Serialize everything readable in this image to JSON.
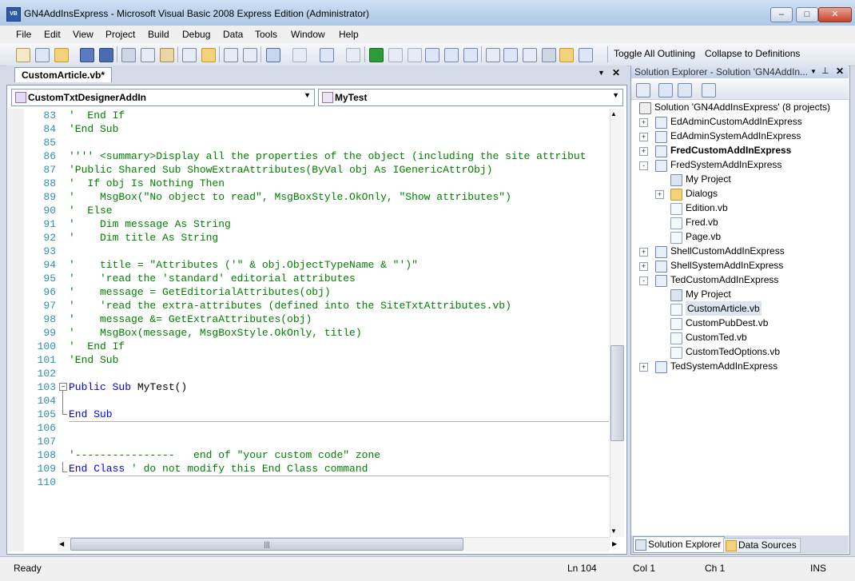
{
  "window": {
    "title": "GN4AddInsExpress - Microsoft Visual Basic 2008 Express Edition (Administrator)",
    "app_icon": "VB"
  },
  "window_buttons": {
    "minimize": "–",
    "maximize": "□",
    "close": "✕"
  },
  "menu": [
    "File",
    "Edit",
    "View",
    "Project",
    "Build",
    "Debug",
    "Data",
    "Tools",
    "Window",
    "Help"
  ],
  "toolbar": {
    "toggle_outlining": "Toggle All Outlining",
    "collapse_defs": "Collapse to Definitions"
  },
  "editor": {
    "tab": "CustomArticle.vb*",
    "tab_close": "✕",
    "class_combo": "CustomTxtDesignerAddIn",
    "method_combo": "MyTest",
    "lines": [
      {
        "n": "83",
        "parts": [
          {
            "s": "'  End If",
            "c": "c"
          }
        ]
      },
      {
        "n": "84",
        "parts": [
          {
            "s": "'End Sub",
            "c": "c"
          }
        ]
      },
      {
        "n": "85",
        "parts": []
      },
      {
        "n": "86",
        "parts": [
          {
            "s": "'''' <summary>Display all the properties of the object (including the site attribut",
            "c": "c"
          }
        ]
      },
      {
        "n": "87",
        "parts": [
          {
            "s": "'Public Shared Sub ShowExtraAttributes(ByVal obj As IGenericAttrObj)",
            "c": "c"
          }
        ]
      },
      {
        "n": "88",
        "parts": [
          {
            "s": "'  If obj Is Nothing Then",
            "c": "c"
          }
        ]
      },
      {
        "n": "89",
        "parts": [
          {
            "s": "'    MsgBox(\"No object to read\", MsgBoxStyle.OkOnly, \"Show attributes\")",
            "c": "c"
          }
        ]
      },
      {
        "n": "90",
        "parts": [
          {
            "s": "'  Else",
            "c": "c"
          }
        ]
      },
      {
        "n": "91",
        "parts": [
          {
            "s": "'    Dim message As String",
            "c": "c"
          }
        ]
      },
      {
        "n": "92",
        "parts": [
          {
            "s": "'    Dim title As String",
            "c": "c"
          }
        ]
      },
      {
        "n": "93",
        "parts": []
      },
      {
        "n": "94",
        "parts": [
          {
            "s": "'    title = \"Attributes ('\" & obj.ObjectTypeName & \"')\"",
            "c": "c"
          }
        ]
      },
      {
        "n": "95",
        "parts": [
          {
            "s": "'    'read the 'standard' editorial attributes",
            "c": "c"
          }
        ]
      },
      {
        "n": "96",
        "parts": [
          {
            "s": "'    message = GetEditorialAttributes(obj)",
            "c": "c"
          }
        ]
      },
      {
        "n": "97",
        "parts": [
          {
            "s": "'    'read the extra-attributes (defined into the SiteTxtAttributes.vb)",
            "c": "c"
          }
        ]
      },
      {
        "n": "98",
        "parts": [
          {
            "s": "'    message &= GetExtraAttributes(obj)",
            "c": "c"
          }
        ]
      },
      {
        "n": "99",
        "parts": [
          {
            "s": "'    MsgBox(message, MsgBoxStyle.OkOnly, title)",
            "c": "c"
          }
        ]
      },
      {
        "n": "100",
        "parts": [
          {
            "s": "'  End If",
            "c": "c"
          }
        ]
      },
      {
        "n": "101",
        "parts": [
          {
            "s": "'End Sub",
            "c": "c"
          }
        ]
      },
      {
        "n": "102",
        "parts": []
      },
      {
        "n": "103",
        "parts": [
          {
            "s": "Public Sub ",
            "c": "k"
          },
          {
            "s": "MyTest()",
            "c": "t"
          }
        ]
      },
      {
        "n": "104",
        "parts": []
      },
      {
        "n": "105",
        "parts": [
          {
            "s": "End Sub",
            "c": "k"
          }
        ]
      },
      {
        "n": "106",
        "parts": []
      },
      {
        "n": "107",
        "parts": []
      },
      {
        "n": "108",
        "parts": [
          {
            "s": "'----------------   end of \"your custom code\" zone",
            "c": "c"
          }
        ]
      },
      {
        "n": "109",
        "parts": [
          {
            "s": "End Class ",
            "c": "k"
          },
          {
            "s": "' do not modify this End Class command",
            "c": "c"
          }
        ]
      },
      {
        "n": "110",
        "parts": []
      }
    ]
  },
  "solution_explorer": {
    "title": "Solution Explorer - Solution 'GN4AddIn...",
    "items": [
      {
        "label": "Solution 'GN4AddInsExpress' (8 projects)",
        "level": 0,
        "icon": "solution-icon",
        "bold": false,
        "expander": ""
      },
      {
        "label": "EdAdminCustomAddInExpress",
        "level": 1,
        "icon": "vb-project-icon",
        "bold": false,
        "expander": "+"
      },
      {
        "label": "EdAdminSystemAddInExpress",
        "level": 1,
        "icon": "vb-project-icon",
        "bold": false,
        "expander": "+"
      },
      {
        "label": "FredCustomAddInExpress",
        "level": 1,
        "icon": "vb-project-icon",
        "bold": true,
        "expander": "+"
      },
      {
        "label": "FredSystemAddInExpress",
        "level": 1,
        "icon": "vb-project-icon",
        "bold": false,
        "expander": "-"
      },
      {
        "label": "My Project",
        "level": 2,
        "icon": "my-project-icon",
        "bold": false,
        "expander": ""
      },
      {
        "label": "Dialogs",
        "level": 2,
        "icon": "folder-icon",
        "bold": false,
        "expander": "+"
      },
      {
        "label": "Edition.vb",
        "level": 2,
        "icon": "vb-file-icon",
        "bold": false,
        "expander": ""
      },
      {
        "label": "Fred.vb",
        "level": 2,
        "icon": "vb-file-icon",
        "bold": false,
        "expander": ""
      },
      {
        "label": "Page.vb",
        "level": 2,
        "icon": "vb-file-icon",
        "bold": false,
        "expander": ""
      },
      {
        "label": "ShellCustomAddInExpress",
        "level": 1,
        "icon": "vb-project-icon",
        "bold": false,
        "expander": "+"
      },
      {
        "label": "ShellSystemAddInExpress",
        "level": 1,
        "icon": "vb-project-icon",
        "bold": false,
        "expander": "+"
      },
      {
        "label": "TedCustomAddInExpress",
        "level": 1,
        "icon": "vb-project-icon",
        "bold": false,
        "expander": "-"
      },
      {
        "label": "My Project",
        "level": 2,
        "icon": "my-project-icon",
        "bold": false,
        "expander": ""
      },
      {
        "label": "CustomArticle.vb",
        "level": 2,
        "icon": "vb-file-icon",
        "bold": false,
        "expander": "",
        "selected": true
      },
      {
        "label": "CustomPubDest.vb",
        "level": 2,
        "icon": "vb-file-icon",
        "bold": false,
        "expander": ""
      },
      {
        "label": "CustomTed.vb",
        "level": 2,
        "icon": "vb-file-icon",
        "bold": false,
        "expander": ""
      },
      {
        "label": "CustomTedOptions.vb",
        "level": 2,
        "icon": "vb-file-icon",
        "bold": false,
        "expander": ""
      },
      {
        "label": "TedSystemAddInExpress",
        "level": 1,
        "icon": "vb-project-icon",
        "bold": false,
        "expander": "+"
      }
    ],
    "tabs": [
      "Solution Explorer",
      "Data Sources"
    ]
  },
  "status_bar": {
    "state": "Ready",
    "line": "Ln 104",
    "col": "Col 1",
    "ch": "Ch 1",
    "mode": "INS"
  },
  "colors": {
    "comment": "#008000",
    "keyword": "#0000ff",
    "line_number": "#2b91af"
  }
}
